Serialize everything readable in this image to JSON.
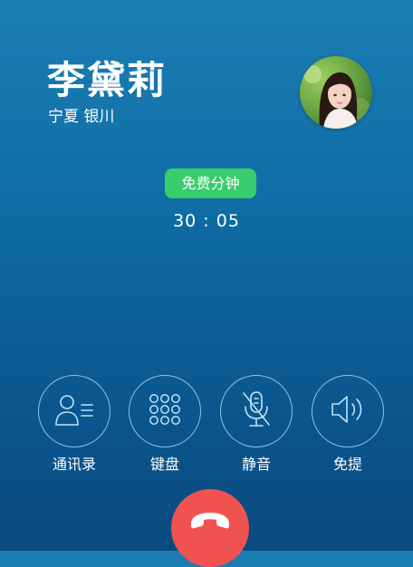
{
  "caller": {
    "name": "李黛莉",
    "location": "宁夏 银川"
  },
  "call": {
    "badge": "免费分钟",
    "timer": "30 : 05"
  },
  "actions": [
    {
      "label": "通讯录",
      "icon": "contacts-icon"
    },
    {
      "label": "键盘",
      "icon": "keypad-icon"
    },
    {
      "label": "静音",
      "icon": "mute-icon"
    },
    {
      "label": "免提",
      "icon": "speaker-icon"
    }
  ],
  "hangup": {
    "icon": "hang-up-icon"
  },
  "colors": {
    "background_top": "#1a7eb3",
    "background_bottom": "#094a80",
    "badge_green": "#38cd6c",
    "hangup_red": "#f0534f",
    "ring_blue": "#a0d7f5"
  }
}
